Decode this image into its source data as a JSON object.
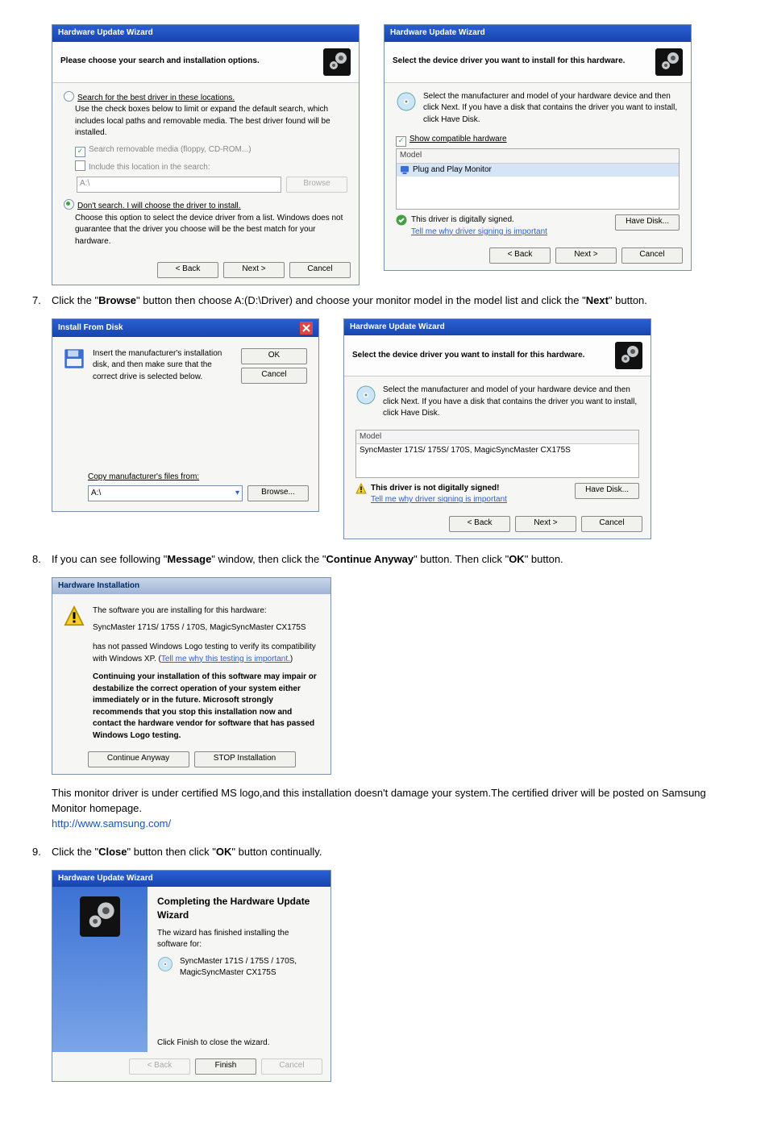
{
  "dlg_title": "Hardware Update Wizard",
  "dlg_install_from_disk": "Install From Disk",
  "dlg_hw_install": "Hardware Installation",
  "wiz1": {
    "header": "Please choose your search and installation options.",
    "opt1": "Search for the best driver in these locations.",
    "opt1_note": "Use the check boxes below to limit or expand the default search, which includes local paths and removable media. The best driver found will be installed.",
    "chk1": "Search removable media (floppy, CD-ROM...)",
    "chk2": "Include this location in the search:",
    "path": "A:\\",
    "browse": "Browse",
    "opt2": "Don't search. I will choose the driver to install.",
    "opt2_note": "Choose this option to select the device driver from a list. Windows does not guarantee that the driver you choose will be the best match for your hardware.",
    "back": "< Back",
    "next": "Next >",
    "cancel": "Cancel"
  },
  "wiz2": {
    "header": "Select the device driver you want to install for this hardware.",
    "note": "Select the manufacturer and model of your hardware device and then click Next. If you have a disk that contains the driver you want to install, click Have Disk.",
    "show_compat": "Show compatible hardware",
    "model_hdr": "Model",
    "model_item": "Plug and Play Monitor",
    "pass_text": "This driver is digitally signed.",
    "pass_link": "Tell me why driver signing is important",
    "have_disk": "Have Disk...",
    "back": "< Back",
    "next": "Next >",
    "cancel": "Cancel"
  },
  "step7": "Click the \"Browse\" button then choose A:(D:\\Driver) and choose your monitor model in the model list and click the \"Next\" button.",
  "ifd": {
    "msg": "Insert the manufacturer's installation disk, and then make sure that the correct drive is selected below.",
    "ok": "OK",
    "cancel": "Cancel",
    "copy_label": "Copy manufacturer's files from:",
    "path": "A:\\",
    "browse": "Browse..."
  },
  "wiz3": {
    "header": "Select the device driver you want to install for this hardware.",
    "note": "Select the manufacturer and model of your hardware device and then click Next. If you have a disk that contains the driver you want to install, click Have Disk.",
    "model_hdr": "Model",
    "model_item": "SyncMaster 171S/ 175S/ 170S, MagicSyncMaster CX175S",
    "warn_text": "This driver is not digitally signed!",
    "warn_link": "Tell me why driver signing is important",
    "have_disk": "Have Disk...",
    "back": "< Back",
    "next": "Next >",
    "cancel": "Cancel"
  },
  "step8": "If you can see following \"Message\" window, then click the \"Continue Anyway\" button. Then click \"OK\" button.",
  "hwi": {
    "l1": "The software you are installing for this hardware:",
    "l2": "SyncMaster 171S/ 175S / 170S, MagicSyncMaster CX175S",
    "l3a": "has not passed Windows Logo testing to verify its compatibility with Windows XP. (",
    "l3b": "Tell me why this testing is important.",
    "l3c": ")",
    "l4": "Continuing your installation of this software may impair or destabilize the correct operation of your system either immediately or in the future. Microsoft strongly recommends that you stop this installation now and contact the hardware vendor for software that has passed Windows Logo testing.",
    "btn_cont": "Continue Anyway",
    "btn_stop": "STOP Installation"
  },
  "annot1": "This monitor driver is under certified MS logo,and this installation doesn't damage your system.The certified driver will be posted on Samsung Monitor homepage.",
  "annot1_link": "http://www.samsung.com/",
  "step9": "Click the \"Close\" button then click \"OK\" button continually.",
  "wiz4": {
    "title": "Completing the Hardware Update Wizard",
    "sub": "The wizard has finished installing the software for:",
    "item": "SyncMaster 171S / 175S / 170S, MagicSyncMaster CX175S",
    "click": "Click Finish to close the wizard.",
    "back": "< Back",
    "finish": "Finish",
    "cancel": "Cancel"
  }
}
